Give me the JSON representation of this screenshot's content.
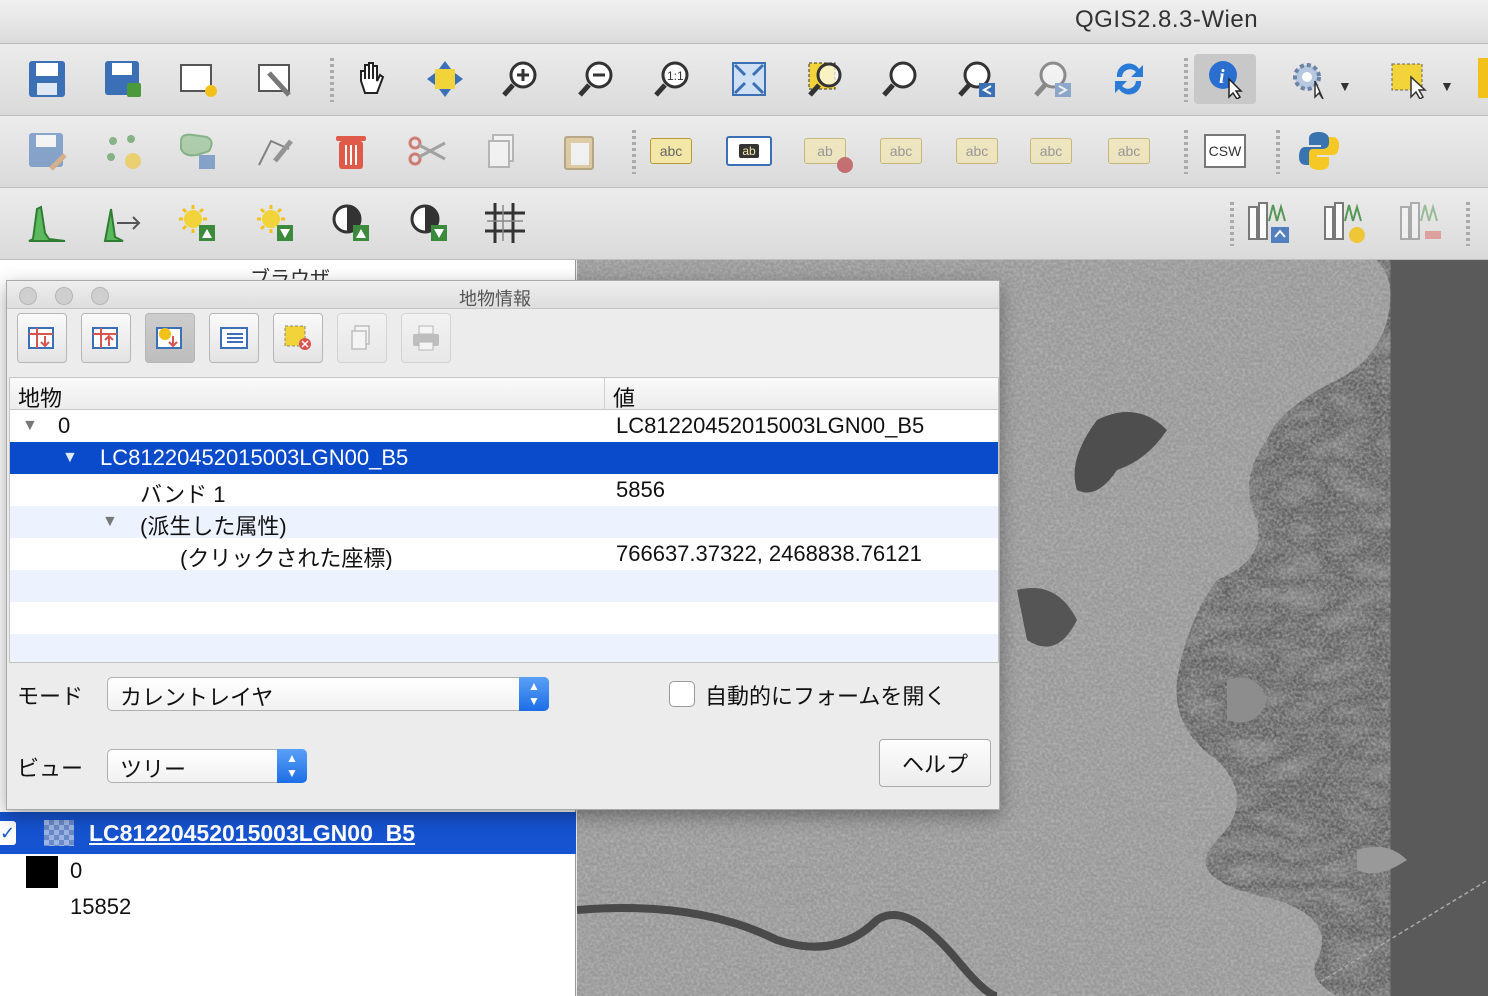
{
  "window": {
    "title": "QGIS2.8.3-Wien"
  },
  "toolbars": {
    "file": [
      "save-project",
      "save-as",
      "new-print-composer",
      "composer-manager"
    ],
    "labels_abc": "abc",
    "labels_ab": "ab",
    "csw_label": "CSW"
  },
  "left_panel": {
    "browser_label": "ブラウザ",
    "layer": {
      "name": "LC81220452015003LGN00_B5",
      "checked": true
    },
    "legend": {
      "min": "0",
      "max": "15852"
    }
  },
  "dialog": {
    "title": "地物情報",
    "columns": {
      "feature": "地物",
      "value": "値"
    },
    "rows": [
      {
        "key": "0",
        "value": "LC81220452015003LGN00_B5"
      },
      {
        "key": "LC81220452015003LGN00_B5",
        "value": ""
      },
      {
        "key": "バンド 1",
        "value": "5856"
      },
      {
        "key": "(派生した属性)",
        "value": ""
      },
      {
        "key": "(クリックされた座標)",
        "value": "766637.37322, 2468838.76121"
      }
    ],
    "mode_label": "モード",
    "mode_value": "カレントレイヤ",
    "view_label": "ビュー",
    "view_value": "ツリー",
    "auto_open_label": "自動的にフォームを開く",
    "auto_open_checked": false,
    "help_button": "ヘルプ"
  },
  "colors": {
    "selection": "#0a4bcb",
    "layer_row": "#1553d0",
    "accent": "#1d6ee6"
  }
}
